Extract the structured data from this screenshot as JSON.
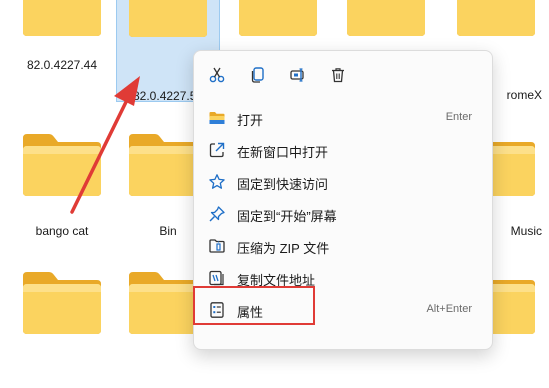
{
  "folders": [
    {
      "name": ""
    },
    {
      "name": ""
    },
    {
      "name": ""
    },
    {
      "name": ""
    },
    {
      "name": ""
    },
    {
      "name": "82.0.4227.44"
    },
    {
      "name": "82.0.4227.5"
    },
    {
      "name": "romeX"
    },
    {
      "name": "bango cat"
    },
    {
      "name": "Bin"
    },
    {
      "name": "Music"
    }
  ],
  "context_menu": {
    "quick_actions": [
      {
        "icon": "cut-icon"
      },
      {
        "icon": "copy-icon"
      },
      {
        "icon": "rename-icon"
      },
      {
        "icon": "delete-icon"
      }
    ],
    "items": [
      {
        "label": "打开",
        "shortcut": "Enter",
        "icon": "folder-icon"
      },
      {
        "label": "在新窗口中打开",
        "shortcut": "",
        "icon": "open-new-window-icon"
      },
      {
        "label": "固定到快速访问",
        "shortcut": "",
        "icon": "star-icon"
      },
      {
        "label": "固定到“开始”屏幕",
        "shortcut": "",
        "icon": "pin-icon"
      },
      {
        "label": "压缩为 ZIP 文件",
        "shortcut": "",
        "icon": "zip-icon"
      },
      {
        "label": "复制文件地址",
        "shortcut": "",
        "icon": "copy-path-icon"
      },
      {
        "label": "属性",
        "shortcut": "Alt+Enter",
        "icon": "properties-icon"
      }
    ]
  },
  "colors": {
    "annotation_red": "#e03b36",
    "selection_blue": "#cfe4f7",
    "folder_yellow": "#f7c948"
  }
}
